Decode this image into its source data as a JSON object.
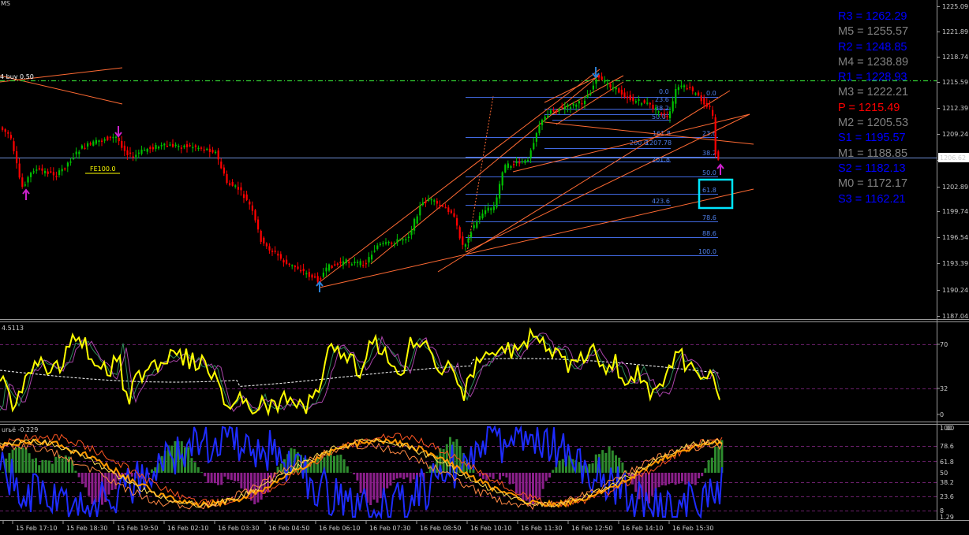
{
  "colors": {
    "background": "#000000",
    "bull": "#00c000",
    "bear": "#ff0000",
    "level_blue": "#0000ff",
    "level_gray": "#808080",
    "pivot_red": "#ff0000",
    "fib": "#4169e1",
    "trend": "#ff6a33",
    "buy_line": "#32cd32",
    "cyan_box": "#00e5ff",
    "rsi": "#ffff00"
  },
  "main": {
    "top_left_label": "MS",
    "buy_label": "4 buy 0.50",
    "fe_label": "FE100.0",
    "current_price": "1206.62",
    "price_ticks": [
      "1225.09",
      "1221.89",
      "1218.74",
      "1215.59",
      "1212.39",
      "1209.24",
      "1206.09",
      "1202.89",
      "1199.74",
      "1196.54",
      "1193.39",
      "1190.24",
      "1187.04"
    ],
    "fib_labels": [
      "0.0",
      "23.6",
      "38.2",
      "50.0",
      "61.8",
      "78.6",
      "88.6",
      "100.0"
    ],
    "fe_labels": [
      "161.8",
      "261.8",
      "423.6",
      "200.0",
      "1207.78"
    ],
    "upper_fib_labels": [
      "23.6",
      "38.2",
      "50.0"
    ]
  },
  "pivots": [
    {
      "label": "R3 = 1262.29",
      "color": "#0000ff"
    },
    {
      "label": "M5 = 1255.57",
      "color": "#808080"
    },
    {
      "label": "R2 = 1248.85",
      "color": "#0000ff"
    },
    {
      "label": "M4 = 1238.89",
      "color": "#808080"
    },
    {
      "label": "R1 = 1228.93",
      "color": "#0000ff"
    },
    {
      "label": "M3 = 1222.21",
      "color": "#808080"
    },
    {
      "label": "P  = 1215.49",
      "color": "#ff0000"
    },
    {
      "label": "M2 = 1205.53",
      "color": "#808080"
    },
    {
      "label": "S1 = 1195.57",
      "color": "#0000ff"
    },
    {
      "label": "M1 = 1188.85",
      "color": "#808080"
    },
    {
      "label": "S2 = 1182.13",
      "color": "#0000ff"
    },
    {
      "label": "M0 = 1172.17",
      "color": "#808080"
    },
    {
      "label": "S3 = 1162.21",
      "color": "#0000ff"
    }
  ],
  "rsi": {
    "label": "4.5113",
    "ticks": [
      "70",
      "32",
      "0"
    ]
  },
  "osc": {
    "label": "urьё -0.229",
    "ticks": [
      "100",
      "78.6",
      "61.8",
      "50",
      "38.2",
      "23.6",
      "8",
      "1.29"
    ],
    "extra_ticks": [
      "00"
    ]
  },
  "time_labels": [
    "15 Feb 17:10",
    "15 Feb 18:30",
    "15 Feb 19:50",
    "16 Feb 02:10",
    "16 Feb 03:30",
    "16 Feb 04:50",
    "16 Feb 06:10",
    "16 Feb 07:30",
    "16 Feb 08:50",
    "16 Feb 10:10",
    "16 Feb 11:30",
    "16 Feb 12:50",
    "16 Feb 14:10",
    "16 Feb 15:30"
  ]
}
